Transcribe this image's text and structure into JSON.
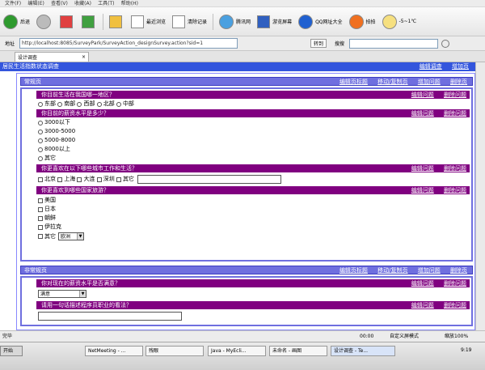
{
  "browser": {
    "menu": [
      "文件(F)",
      "编辑(E)",
      "查看(V)",
      "收藏(A)",
      "工具(T)",
      "帮助(H)"
    ],
    "toolbar": {
      "back": "后退",
      "recent": "最近浏览",
      "history": "清除记录",
      "tencent": "腾讯网",
      "fullscreen": "游览屏幕",
      "qq": "QQ网址大全",
      "snapshot": "拍拍",
      "weather": "-5~1℃"
    },
    "address_label": "地址",
    "url": "http://localhost:8085/SurveyPark/SurveyAction_designSurvey.action?sid=1",
    "go": "转到",
    "search_label": "搜搜",
    "tab_title": "设计调查",
    "status": "完毕",
    "status_time": "00:00",
    "status_mode": "自定义屏模式",
    "zoom": "缩放100%"
  },
  "survey": {
    "title": "居民生活指数状态调查",
    "edit_survey": "编辑调查",
    "add_page": "增加页",
    "pages": [
      {
        "title": "常规页",
        "actions": [
          "编辑页标题",
          "移动/复制页",
          "增加问题",
          "删除页"
        ]
      },
      {
        "title": "非常规页",
        "actions": [
          "编辑页标题",
          "移动/复制页",
          "增加问题",
          "删除页"
        ]
      }
    ],
    "question_actions": [
      "编辑问题",
      "删除问题"
    ],
    "questions": [
      {
        "title": "你目前生活在我国哪一地区？",
        "options": [
          "东部",
          "南部",
          "西部",
          "北部",
          "中部"
        ]
      },
      {
        "title": "你目前的薪资水平是多少？",
        "options": [
          "3000以下",
          "3000-5000",
          "5000-8000",
          "8000以上",
          "其它"
        ]
      },
      {
        "title": "你更喜欢在以下哪些城市工作和生活？",
        "options": [
          "北京",
          "上海",
          "大连",
          "深圳",
          "其它"
        ]
      },
      {
        "title": "你更喜欢到哪些国家旅游？",
        "options": [
          "美国",
          "日本",
          "朝鲜",
          "伊拉克",
          "其它"
        ],
        "other_select": "欧洲"
      },
      {
        "title": "你对现在的薪资水平是否满意？",
        "select_value": "满意"
      },
      {
        "title": "请用一句话描述程序员职业的看法？"
      }
    ]
  },
  "taskbar": {
    "start": "开始",
    "tasks": [
      "NetMeeting - ...",
      "残眼",
      "Java - MyEcli...",
      "未命名 - 画图",
      "设计调查 - Te..."
    ],
    "clock": "9:19"
  }
}
